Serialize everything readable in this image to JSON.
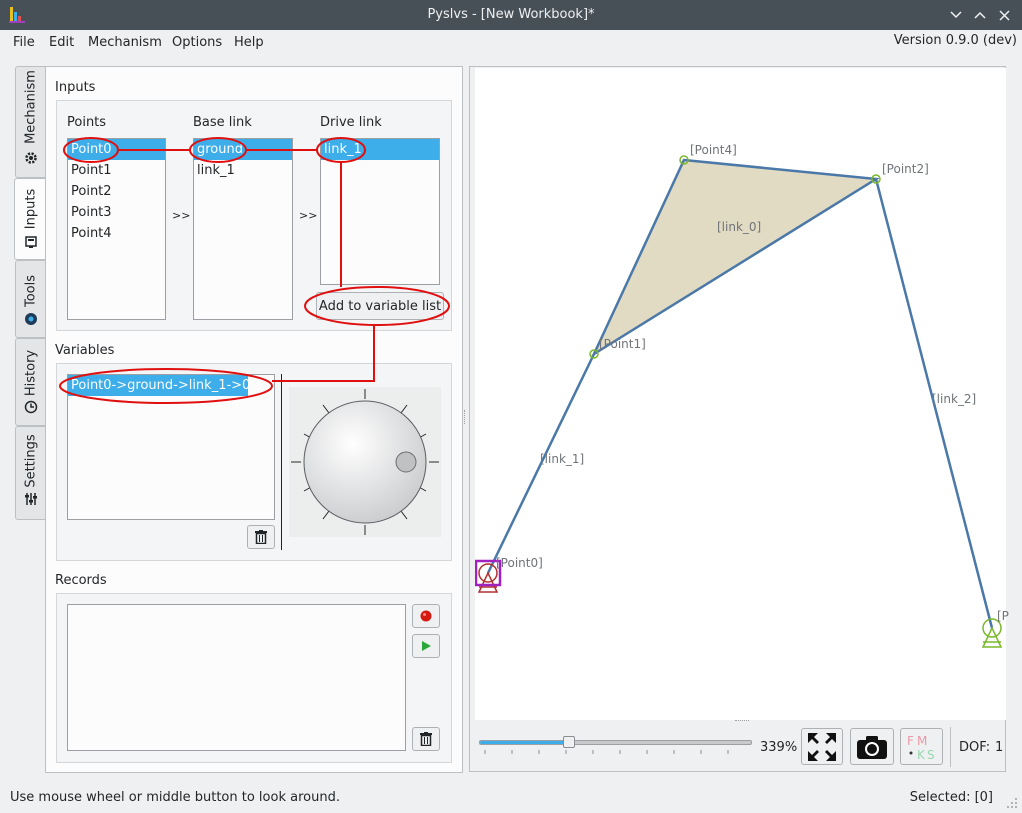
{
  "window": {
    "title": "Pyslvs - [New Workbook]*",
    "app_icon": "pyslvs-logo-icon",
    "controls": [
      "minimize-icon",
      "maximize-icon",
      "close-icon"
    ]
  },
  "menubar": {
    "items": [
      "File",
      "Edit",
      "Mechanism",
      "Options",
      "Help"
    ],
    "version": "Version 0.9.0 (dev)"
  },
  "tabs": [
    {
      "label": "Mechanism",
      "icon": "gear-icon",
      "active": false
    },
    {
      "label": "Inputs",
      "icon": "pen-icon",
      "active": true
    },
    {
      "label": "Tools",
      "icon": "tools-icon",
      "active": false
    },
    {
      "label": "History",
      "icon": "clock-icon",
      "active": false
    },
    {
      "label": "Settings",
      "icon": "sliders-icon",
      "active": false
    }
  ],
  "inputs": {
    "title": "Inputs",
    "points_label": "Points",
    "base_link_label": "Base link",
    "drive_link_label": "Drive link",
    "points": [
      "Point0",
      "Point1",
      "Point2",
      "Point3",
      "Point4"
    ],
    "base_links": [
      "ground",
      "link_1"
    ],
    "drive_links": [
      "link_1"
    ],
    "arrow_1": ">>",
    "arrow_2": ">>",
    "add_button": "Add to variable list"
  },
  "variables": {
    "title": "Variables",
    "items": [
      "Point0->ground->link_1->0.0"
    ],
    "delete_icon": "trash-icon",
    "dial_icon": "rotary-dial"
  },
  "records": {
    "title": "Records",
    "record_icon": "record-icon",
    "play_icon": "play-icon",
    "delete_icon": "trash-icon"
  },
  "canvas": {
    "point_labels": [
      "[Point4]",
      "[Point2]",
      "[Point1]",
      "[Point0]",
      "[P"
    ],
    "link_labels": [
      "[link_0]",
      "[link_2]",
      "[link_1]"
    ],
    "fill_color": "#e2dbc3",
    "link_color": "#4a78a8",
    "point_color": "#7ab82a",
    "selection_color": "#a020c0"
  },
  "zoom_bar": {
    "zoom_value": 0.33,
    "zoom_text": "339%",
    "fit_icon": "fit-view-icon",
    "camera_icon": "camera-icon",
    "fmks_icon": "fmks-icon",
    "dof_label": "DOF:",
    "dof_value": "1"
  },
  "statusbar": {
    "hint": "Use mouse wheel or middle button to look around.",
    "selected": "Selected: [0]"
  },
  "colors": {
    "accent": "#3daee9",
    "annotation_red": "#e01010",
    "titlebar": "#475057"
  }
}
